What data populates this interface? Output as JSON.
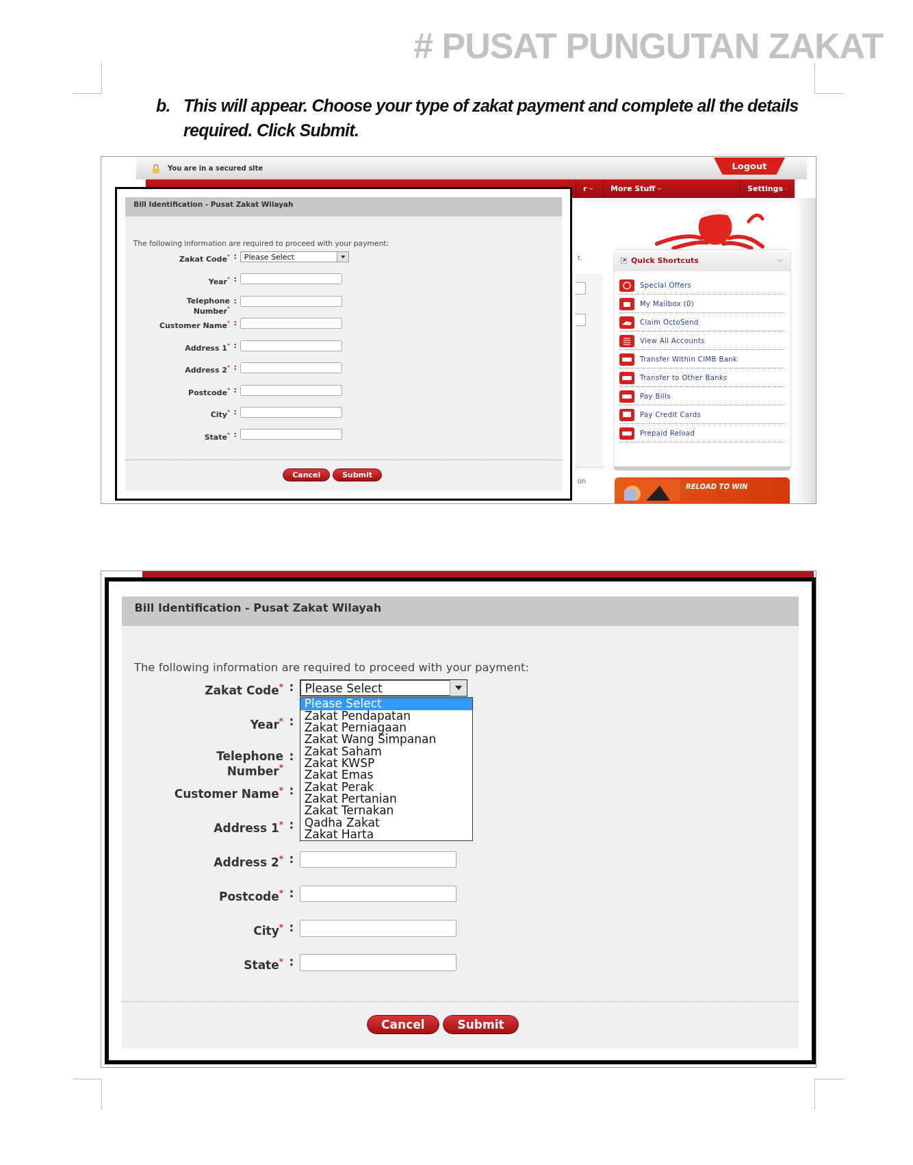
{
  "page_title": "# PUSAT PUNGUTAN ZAKAT",
  "instruction": {
    "marker": "b.",
    "text": "This will appear. Choose your type of zakat payment and complete all the details required. Click Submit."
  },
  "screenshot_1": {
    "top_bar": {
      "notice": "You are in a secured site",
      "logout": "Logout"
    },
    "nav": [
      {
        "label": "r"
      },
      {
        "label": "More Stuff"
      },
      {
        "label": "Settings"
      }
    ],
    "fragments": [
      "r.",
      "on"
    ],
    "form": {
      "title": "Bill Identification - Pusat Zakat Wilayah",
      "intro": "The following information are required to proceed with your payment:",
      "fields": [
        {
          "label": "Zakat Code$^{*}$",
          "colon": ":",
          "kind": "select",
          "value": "Please Select"
        },
        {
          "label": "Year$^{*}$",
          "colon": ":",
          "kind": "text"
        },
        {
          "label": "Telephone\nNumber$^{*}$",
          "colon": ":",
          "kind": "text"
        },
        {
          "label": "Customer Name$^{*}$",
          "colon": ":",
          "kind": "text"
        },
        {
          "label": "Address 1$^{*}$",
          "colon": ":",
          "kind": "text"
        },
        {
          "label": "Address 2$^{*}$",
          "colon": ":",
          "kind": "text"
        },
        {
          "label": "Postcode$^{*}$",
          "colon": ":",
          "kind": "text"
        },
        {
          "label": "City$^{*}$",
          "colon": ":",
          "kind": "text"
        },
        {
          "label": "State$^{*}$",
          "colon": ":",
          "kind": "text"
        }
      ],
      "buttons": [
        "Cancel",
        "Submit"
      ]
    },
    "quick_shortcuts": {
      "title": "Quick Shortcuts",
      "items": [
        "Special Offers",
        "My Mailbox  (0)",
        "Claim OctoSend",
        "View All Accounts",
        "Transfer Within CIMB Bank",
        "Transfer to Other Banks",
        "Pay Bills",
        "Pay Credit Cards",
        "Prepaid Reload"
      ]
    },
    "banner": {
      "text": "RELOAD TO WIN"
    }
  },
  "screenshot_2": {
    "form": {
      "title": "Bill Identification - Pusat Zakat Wilayah",
      "intro": "The following information are required to proceed with your payment:",
      "fields": [
        {
          "label": "Zakat Code$^{*}$",
          "colon": ":",
          "kind": "select",
          "value": "Please Select",
          "open": true,
          "options": [
            {
              "label": "Please Select",
              "selected": true
            },
            {
              "label": "Zakat Pendapatan",
              "selected": false
            },
            {
              "label": "Zakat Perniagaan",
              "selected": false
            },
            {
              "label": "Zakat Wang Simpanan",
              "selected": false
            },
            {
              "label": "Zakat Saham",
              "selected": false
            },
            {
              "label": "Zakat KWSP",
              "selected": false
            },
            {
              "label": "Zakat Emas",
              "selected": false
            },
            {
              "label": "Zakat Perak",
              "selected": false
            },
            {
              "label": "Zakat Pertanian",
              "selected": false
            },
            {
              "label": "Zakat Ternakan",
              "selected": false
            },
            {
              "label": "Qadha Zakat",
              "selected": false
            },
            {
              "label": "Zakat Harta",
              "selected": false
            }
          ]
        },
        {
          "label": "Year$^{*}$",
          "colon": ":",
          "kind": "covered"
        },
        {
          "label": "Telephone\nNumber$^{*}$",
          "colon": ":",
          "kind": "covered"
        },
        {
          "label": "Customer Name$^{*}$",
          "colon": ":",
          "kind": "covered"
        },
        {
          "label": "Address 1$^{*}$",
          "colon": ":",
          "kind": "covered"
        },
        {
          "label": "Address 2$^{*}$",
          "colon": ":",
          "kind": "text"
        },
        {
          "label": "Postcode$^{*}$",
          "colon": ":",
          "kind": "text"
        },
        {
          "label": "City$^{*}$",
          "colon": ":",
          "kind": "text"
        },
        {
          "label": "State$^{*}$",
          "colon": ":",
          "kind": "text"
        }
      ],
      "buttons": [
        "Cancel",
        "Submit"
      ]
    }
  }
}
